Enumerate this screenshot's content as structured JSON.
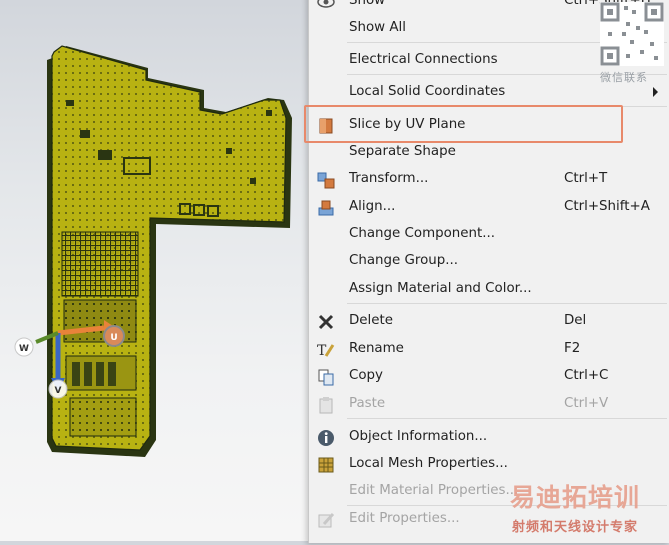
{
  "colors": {
    "board": "#b8b212",
    "board_edge": "#1f2a10",
    "highlight": "#e8896a",
    "menu_bg": "#f1f1f1"
  },
  "axes": {
    "u_label": "U",
    "v_label": "V",
    "w_label": "W"
  },
  "menu": {
    "items": [
      {
        "label": "Show",
        "shortcut": "Ctrl+Shift+H",
        "icon": "eye-icon",
        "enabled": true
      },
      {
        "label": "Show All",
        "shortcut": "",
        "icon": "",
        "enabled": true
      },
      {
        "label": "Electrical Connections",
        "shortcut": "",
        "icon": "",
        "submenu": true,
        "enabled": true
      },
      {
        "label": "Local Solid Coordinates",
        "shortcut": "",
        "icon": "",
        "submenu": true,
        "enabled": true
      },
      {
        "label": "Slice by UV Plane",
        "shortcut": "",
        "icon": "slice-icon",
        "enabled": true,
        "highlighted": true
      },
      {
        "label": "Separate Shape",
        "shortcut": "",
        "icon": "",
        "enabled": true
      },
      {
        "label": "Transform...",
        "shortcut": "Ctrl+T",
        "icon": "transform-icon",
        "enabled": true
      },
      {
        "label": "Align...",
        "shortcut": "Ctrl+Shift+A",
        "icon": "align-icon",
        "enabled": true
      },
      {
        "label": "Change Component...",
        "shortcut": "",
        "icon": "",
        "enabled": true
      },
      {
        "label": "Change Group...",
        "shortcut": "",
        "icon": "",
        "enabled": true
      },
      {
        "label": "Assign Material and Color...",
        "shortcut": "",
        "icon": "",
        "enabled": true
      },
      {
        "label": "Delete",
        "shortcut": "Del",
        "icon": "delete-icon",
        "enabled": true
      },
      {
        "label": "Rename",
        "shortcut": "F2",
        "icon": "rename-icon",
        "enabled": true
      },
      {
        "label": "Copy",
        "shortcut": "Ctrl+C",
        "icon": "copy-icon",
        "enabled": true
      },
      {
        "label": "Paste",
        "shortcut": "Ctrl+V",
        "icon": "paste-icon",
        "enabled": false
      },
      {
        "label": "Object Information...",
        "shortcut": "",
        "icon": "info-icon",
        "enabled": true
      },
      {
        "label": "Local Mesh Properties...",
        "shortcut": "",
        "icon": "mesh-icon",
        "enabled": true
      },
      {
        "label": "Edit Material Properties...",
        "shortcut": "",
        "icon": "",
        "enabled": false
      },
      {
        "label": "Edit Properties...",
        "shortcut": "",
        "icon": "edit-properties-icon",
        "enabled": false
      }
    ]
  },
  "watermark": {
    "qr_caption": "微信联系",
    "brand": "易迪拓培训",
    "tagline": "射频和天线设计专家"
  }
}
